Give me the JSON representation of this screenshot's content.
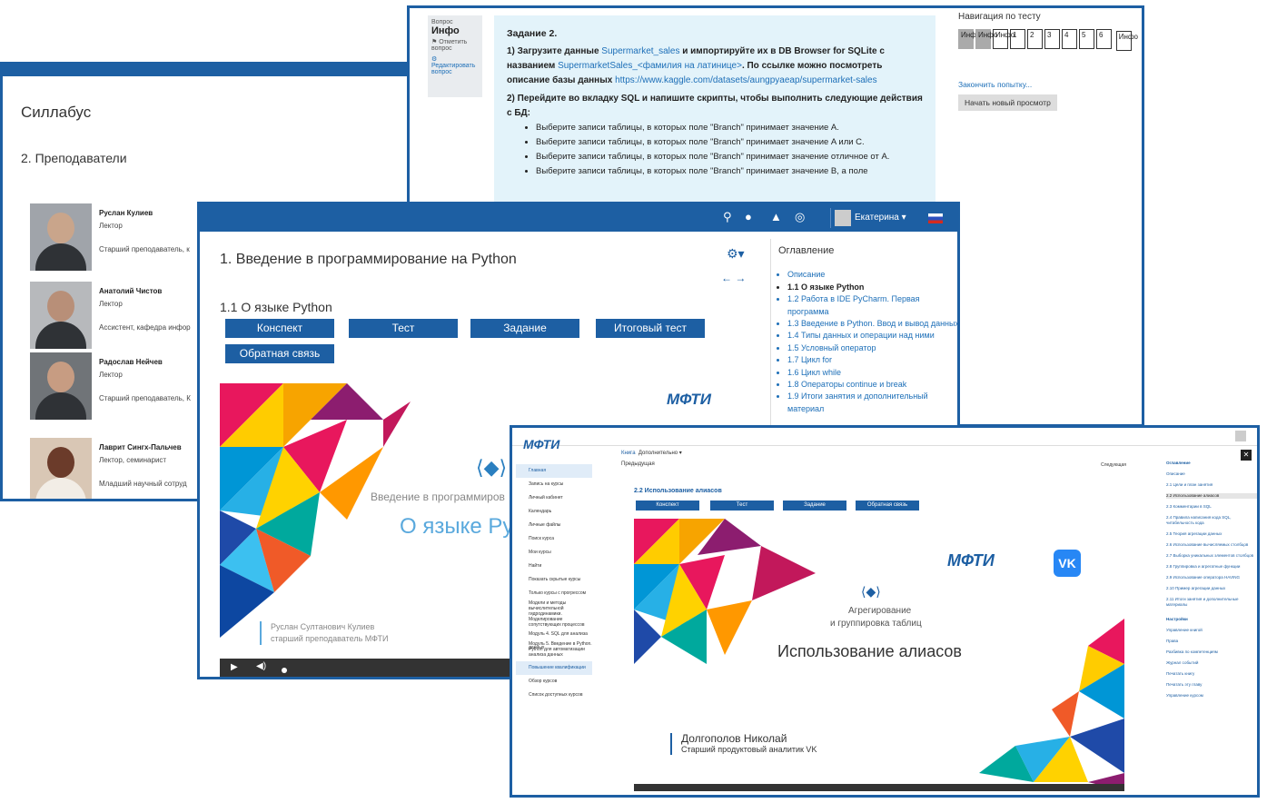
{
  "syllabus": {
    "title": "Силлабус",
    "section": "2. Преподаватели",
    "people": [
      {
        "name": "Руслан Кулиев",
        "role": "Лектор",
        "position": "Старший преподаватель, к"
      },
      {
        "name": "Анатолий Чистов",
        "role": "Лектор",
        "position": "Ассистент, кафедра инфор"
      },
      {
        "name": "Радослав Нейчев",
        "role": "Лектор",
        "position": "Старший преподаватель, К"
      },
      {
        "name": "Лаврит Сингх-Пальчев",
        "role": "Лектор, семинарист",
        "position": "Младший научный сотруд"
      }
    ]
  },
  "quiz": {
    "info": {
      "label": "Вопрос",
      "title": "Инфо",
      "flag": "Отметить вопрос",
      "edit": "Редактировать вопрос"
    },
    "task": {
      "title": "Задание 2.",
      "p1_a": "1) Загрузите данные ",
      "p1_link1": "Supermarket_sales",
      "p1_b": " и импортируйте их в DB Browser for SQLite с названием ",
      "p1_link2": "SupermarketSales_<фамилия на латинице>",
      "p1_c": ". По ссылке можно посмотреть описание базы данных ",
      "p1_link3": "https://www.kaggle.com/datasets/aungpyaeap/supermarket-sales",
      "p2": "2) Перейдите во вкладку SQL и напишите скрипты, чтобы выполнить следующие действия с БД:",
      "items": [
        "Выберите записи таблицы, в которых поле \"Branch\" принимает значение A.",
        "Выберите записи таблицы, в которых поле \"Branch\" принимает значение A или C.",
        "Выберите записи таблицы, в которых поле \"Branch\" принимает значение отличное от A.",
        "Выберите записи таблицы, в которых поле \"Branch\" принимает значение B, а поле"
      ]
    },
    "nav": {
      "title": "Навигация по тесту",
      "buttons": [
        "Инфо",
        "Инфо",
        "Инфо",
        "1",
        "2",
        "3",
        "4",
        "5",
        "6",
        "Инфо"
      ],
      "finish": "Закончить попытку...",
      "new_view": "Начать новый просмотр"
    }
  },
  "course": {
    "user": "Екатерина",
    "title": "1. Введение в программирование на Python",
    "subtitle": "1.1 О языке Python",
    "buttons": [
      "Конспект",
      "Тест",
      "Задание",
      "Итоговый тест",
      "Обратная связь"
    ],
    "slide_logo": "МФТИ",
    "slide_caption": "Введение в программиров",
    "slide_title": "О языке Ру",
    "slide_author": "Руслан Султанович Кулиев",
    "slide_author_pos": "старший преподаватель МФТИ",
    "toc_title": "Оглавление",
    "toc": [
      "Описание",
      "1.1 О языке Python",
      "1.2 Работа в IDE PyCharm. Первая программа",
      "1.3 Введение в Python. Ввод и вывод данных",
      "1.4 Типы данных и операции над ними",
      "1.5 Условный оператор",
      "1.7 Цикл for",
      "1.6 Цикл while",
      "1.8 Операторы continue и break",
      "1.9 Итоги занятия и дополнительный материал"
    ]
  },
  "sql": {
    "logo": "МФТИ",
    "sidebar": [
      "Главная",
      "Запись на курсы",
      "Личный кабинет",
      "Календарь",
      "Личные файлы",
      "Поиск курса",
      "Мои курсы",
      "Найти",
      "Показать скрытые курсы",
      "Только курсы с прогрессом",
      "Модели и методы вычислительной гидродинамики. Моделирование сопутствующих процессов",
      "Модуль 4. SQL для анализа данных",
      "Модуль 5. Введение в Python. Python для автоматизации анализа данных",
      "Повышение квалификации",
      "Обзор курсов",
      "Список доступных курсов"
    ],
    "tabs": [
      "Книга",
      "Дополнительно ▾"
    ],
    "prev": "Предыдущая",
    "next": "Следующая",
    "section": "2.2 Использование алиасов",
    "buttons": [
      "Конспект",
      "Тест",
      "Задание",
      "Обратная связь"
    ],
    "slide_l1": "Агрегирование",
    "slide_l2": "и группировка таблиц",
    "slide_title": "Использование алиасов",
    "slide_author": "Долгополов Николай",
    "slide_pos": "Старший продуктовый аналитик VK",
    "toc_title": "Оглавление",
    "toc": [
      "Описание",
      "2.1 Цели и план занятия",
      "2.2 Использование алиасов",
      "2.3 Комментарии в SQL",
      "2.4 Правила написания кода SQL, читабельность кода",
      "2.5 Теория агрегации данных",
      "2.6 Использование вычисляемых столбцов",
      "2.7 Выборка уникальных элементов столбцов",
      "2.8 Группировка и агрегатные функции",
      "2.9 Использование оператора HAVING",
      "2.10 Пример агрегации данных",
      "2.11 Итоги занятия и дополнительные материалы"
    ],
    "settings": "Настройки",
    "settings_items": [
      "Управление книгой",
      "Права",
      "Разбивка по компетенциям",
      "Журнал событий",
      "Печатать книгу",
      "Печатать эту главу",
      "Управление курсом"
    ]
  }
}
